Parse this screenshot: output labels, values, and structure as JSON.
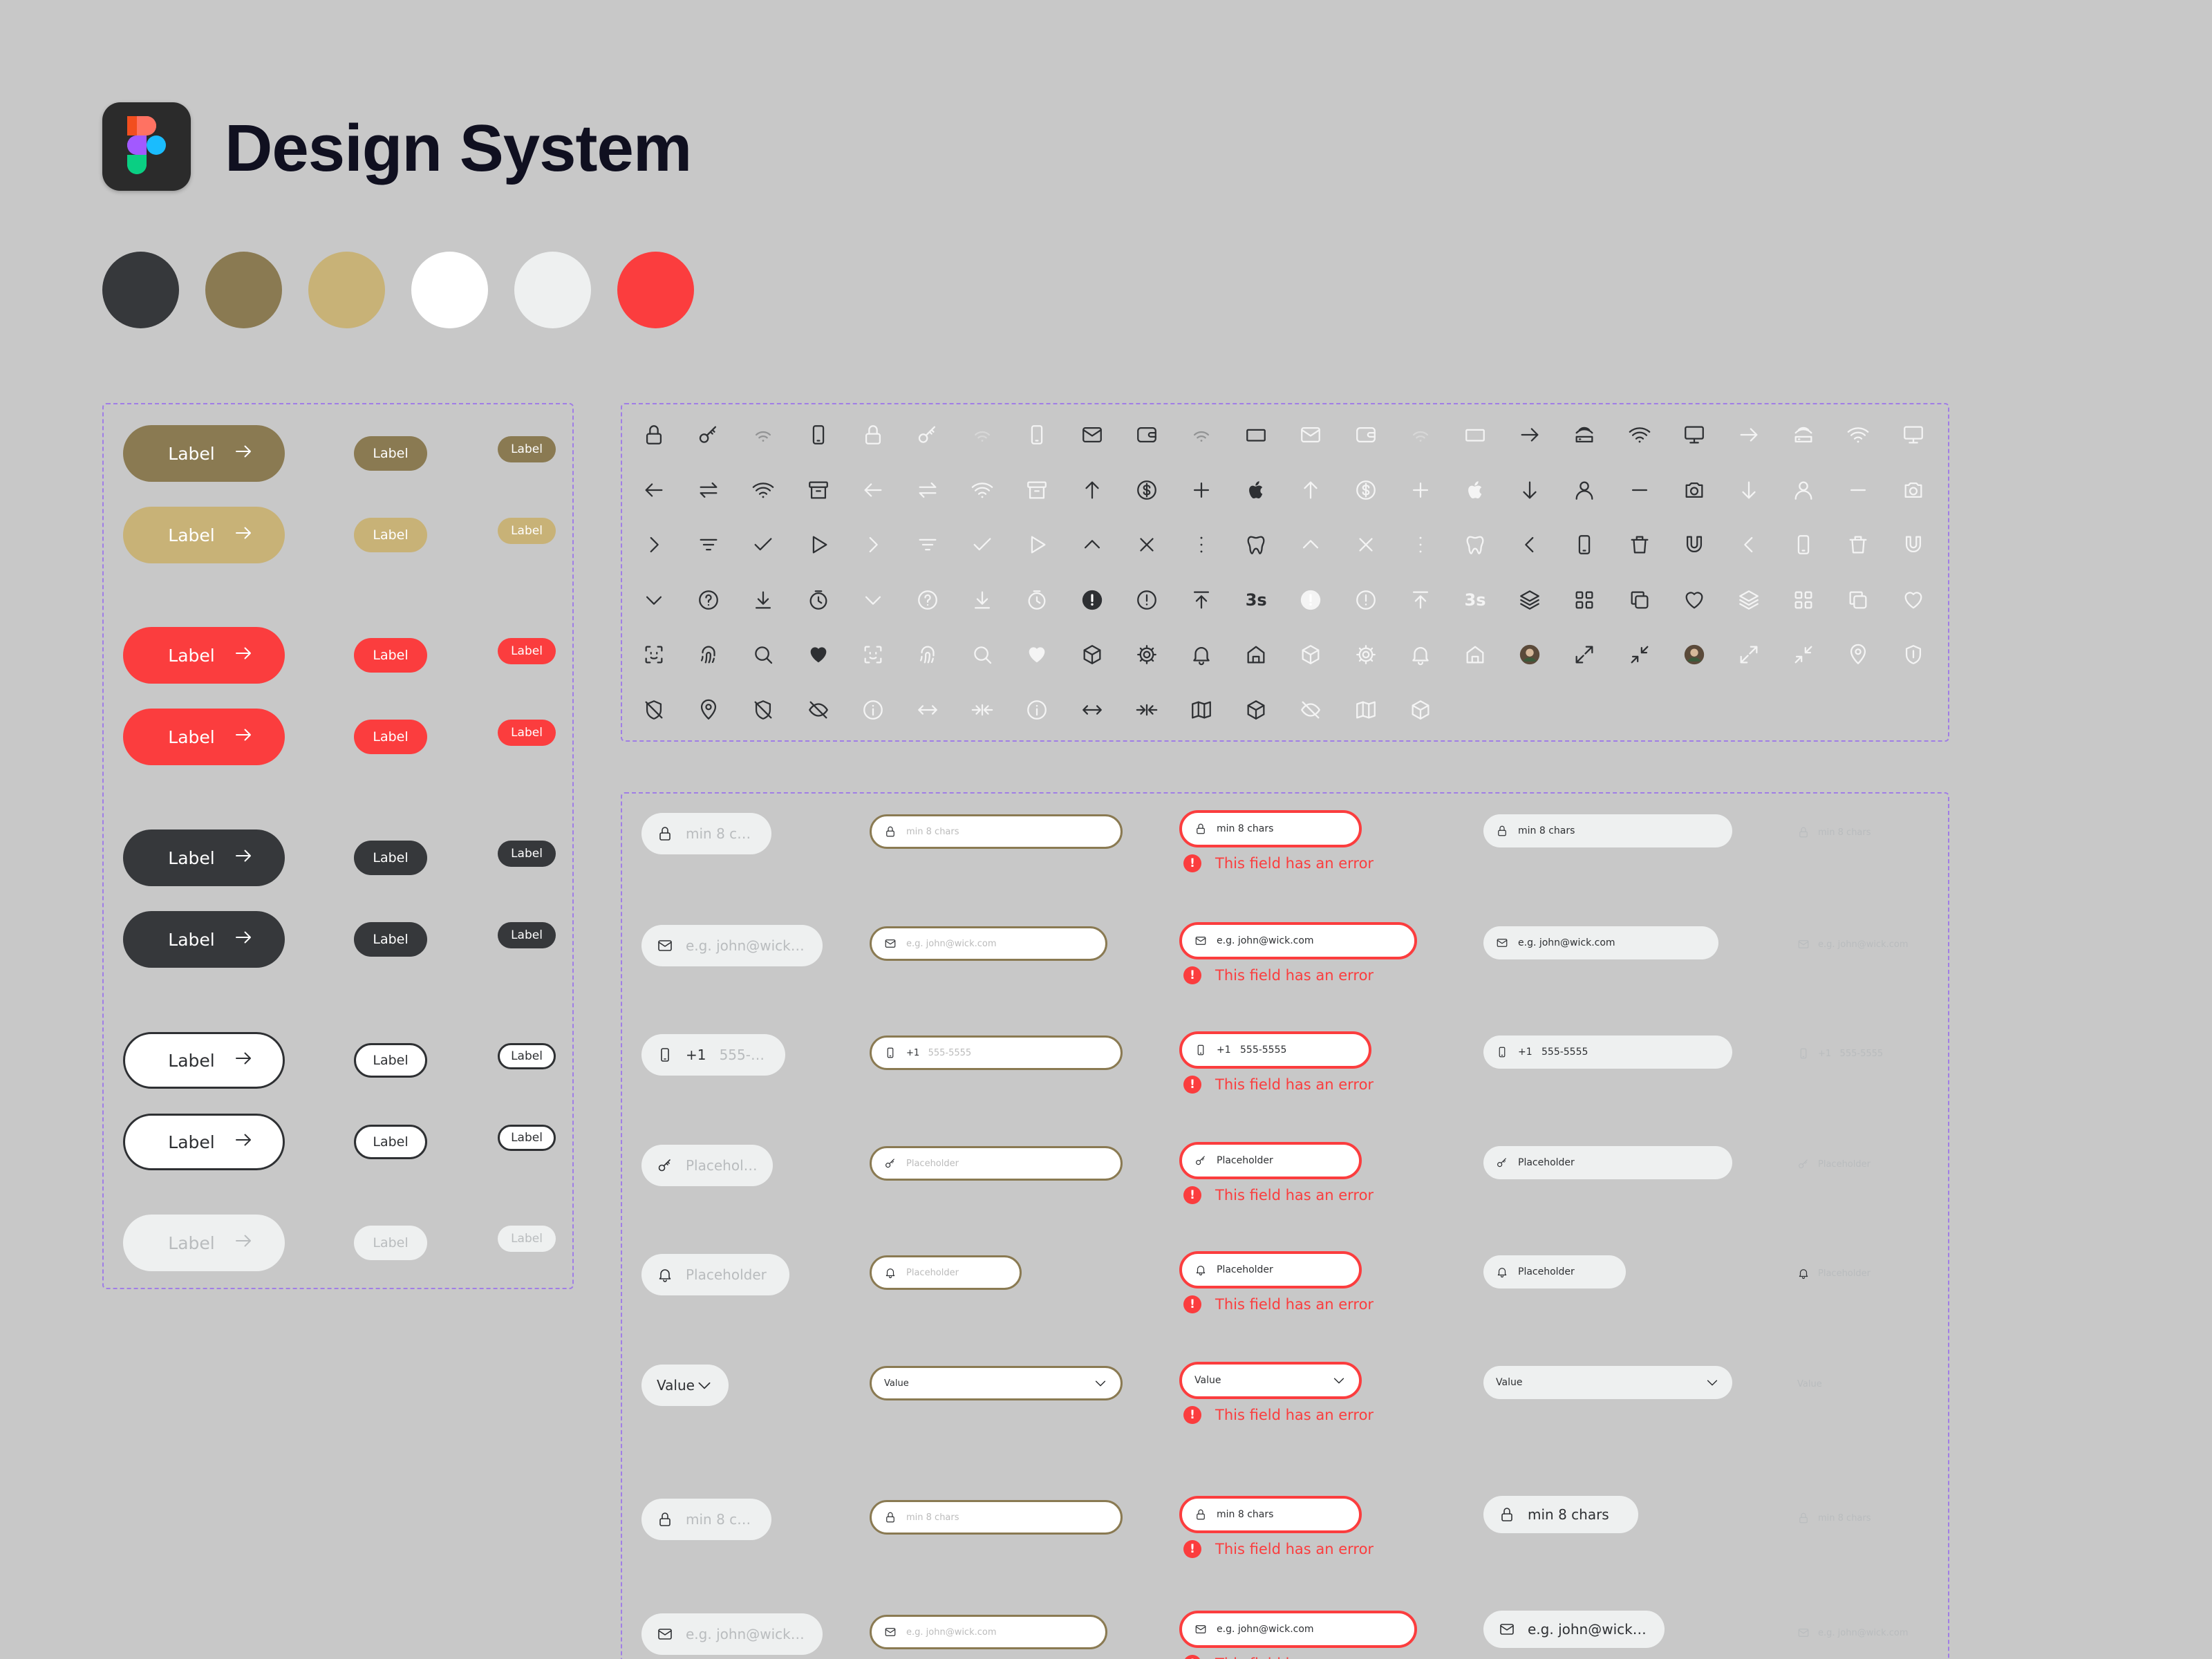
{
  "header": {
    "title": "Design System"
  },
  "colors": {
    "palette": [
      "#36383b",
      "#8a7a52",
      "#c8b277",
      "#ffffff",
      "#eef0f0",
      "#fb3d3e"
    ],
    "accent_purple": "#a07ee6"
  },
  "buttons": {
    "label": "Label"
  },
  "icons": {
    "row1": [
      "lock-icon",
      "key-icon",
      "wifi-weak-icon",
      "phone-icon",
      "lock-icon",
      "key-icon",
      "wifi-weak-icon",
      "phone-icon",
      "mail-icon",
      "wallet-icon",
      "wifi-weak-icon",
      "rectangle-icon",
      "mail-icon",
      "wallet-icon",
      "wifi-weak-icon",
      "rectangle-icon",
      "arrow-right-icon",
      "router-icon",
      "wifi-icon",
      "monitor-icon",
      "arrow-right-icon",
      "router-icon",
      "wifi-icon",
      "monitor-icon"
    ],
    "row2": [
      "arrow-left-icon",
      "swap-icon",
      "wifi-icon",
      "archive-icon",
      "arrow-left-icon",
      "swap-icon",
      "wifi-icon",
      "archive-icon",
      "arrow-up-icon",
      "dollar-icon",
      "plus-icon",
      "apple-icon",
      "arrow-up-icon",
      "dollar-icon",
      "plus-icon",
      "apple-icon",
      "arrow-down-icon",
      "user-icon",
      "minus-icon",
      "camera-icon",
      "arrow-down-icon",
      "user-icon",
      "minus-icon",
      "camera-icon"
    ],
    "row3": [
      "chevron-right-icon",
      "filter-icon",
      "check-icon",
      "play-icon",
      "chevron-right-icon",
      "filter-icon",
      "check-icon",
      "play-icon",
      "chevron-up-icon",
      "close-icon",
      "more-vertical-icon",
      "tooth-icon",
      "chevron-up-icon",
      "close-icon",
      "more-vertical-icon",
      "tooth-icon",
      "chevron-left-icon",
      "phone-icon",
      "trash-icon",
      "magnet-icon",
      "chevron-left-icon",
      "phone-icon",
      "trash-icon",
      "magnet-icon"
    ],
    "row4": [
      "chevron-down-icon",
      "help-icon",
      "download-icon",
      "timer-icon",
      "chevron-down-icon",
      "help-icon",
      "download-icon",
      "timer-icon",
      "alert-filled-icon",
      "alert-icon",
      "upload-icon",
      "countdown-text-icon",
      "alert-filled-icon",
      "alert-icon",
      "upload-icon",
      "countdown-text-icon",
      "layers-icon",
      "grid-icon",
      "copy-icon",
      "heart-icon",
      "layers-icon",
      "grid-icon",
      "copy-icon",
      "heart-icon"
    ],
    "row5": [
      "face-scan-icon",
      "fingerprint-icon",
      "search-icon",
      "heart-filled-icon",
      "face-scan-icon",
      "fingerprint-icon",
      "search-icon",
      "heart-filled-icon",
      "cube-icon",
      "settings-icon",
      "bell-icon",
      "home-icon",
      "cube-icon",
      "settings-icon",
      "bell-icon",
      "home-icon",
      "avatar-icon",
      "expand-icon",
      "collapse-icon",
      "avatar-icon",
      "expand-icon",
      "collapse-icon",
      "location-icon",
      "shield-icon"
    ],
    "row6": [
      "shield-off-icon",
      "location-icon",
      "shield-off-icon",
      "eye-off-icon",
      "info-icon",
      "arrows-horizontal-icon",
      "arrows-inward-icon",
      "info-icon",
      "arrows-horizontal-icon",
      "arrows-inward-icon",
      "map-icon",
      "box-icon",
      "eye-off-icon",
      "map-icon",
      "box-icon"
    ],
    "countdown_text": "3s"
  },
  "inputs": {
    "password_placeholder": "min 8 chars",
    "email_placeholder": "e.g. john@wick.com",
    "phone_prefix": "+1",
    "phone_placeholder": "555-5555",
    "generic_placeholder": "Placeholder",
    "select_value": "Value",
    "error_message": "This field has an error"
  }
}
